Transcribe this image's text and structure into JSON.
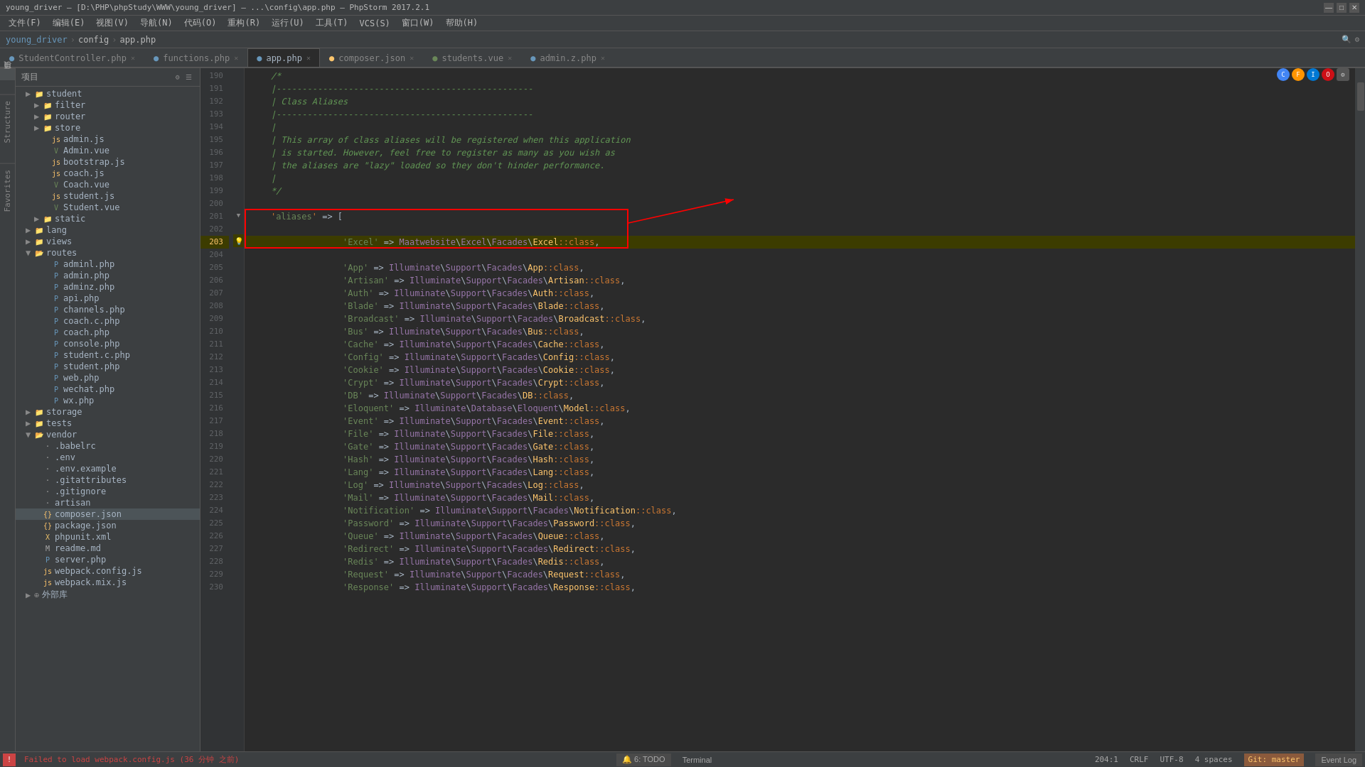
{
  "titleBar": {
    "title": "young_driver – [D:\\PHP\\phpStudy\\WWW\\young_driver] – ...\\config\\app.php – PhpStorm 2017.2.1",
    "minBtn": "—",
    "maxBtn": "□",
    "closeBtn": "✕"
  },
  "menuBar": {
    "items": [
      "文件(F)",
      "编辑(E)",
      "视图(V)",
      "导航(N)",
      "代码(O)",
      "重构(R)",
      "运行(U)",
      "工具(T)",
      "VCS(S)",
      "窗口(W)",
      "帮助(H)"
    ]
  },
  "breadcrumb": {
    "items": [
      "young_driver",
      "config",
      "app.php"
    ]
  },
  "tabs": [
    {
      "label": "StudentController.php",
      "type": "php",
      "active": false
    },
    {
      "label": "functions.php",
      "type": "php",
      "active": false
    },
    {
      "label": "app.php",
      "type": "php",
      "active": true
    },
    {
      "label": "composer.json",
      "type": "json",
      "active": false
    },
    {
      "label": "students.vue",
      "type": "vue",
      "active": false
    },
    {
      "label": "admin.z.php",
      "type": "php",
      "active": false
    }
  ],
  "projectPanel": {
    "title": "项目",
    "treeItems": [
      {
        "label": "student",
        "type": "folder",
        "indent": 2,
        "expanded": false
      },
      {
        "label": "filter",
        "type": "folder",
        "indent": 3,
        "expanded": false
      },
      {
        "label": "router",
        "type": "folder",
        "indent": 3,
        "expanded": false
      },
      {
        "label": "store",
        "type": "folder",
        "indent": 3,
        "expanded": false
      },
      {
        "label": "admin.js",
        "type": "js",
        "indent": 3
      },
      {
        "label": "Admin.vue",
        "type": "vue",
        "indent": 3
      },
      {
        "label": "bootstrap.js",
        "type": "js",
        "indent": 3
      },
      {
        "label": "coach.js",
        "type": "js",
        "indent": 3
      },
      {
        "label": "Coach.vue",
        "type": "vue",
        "indent": 3
      },
      {
        "label": "student.js",
        "type": "js",
        "indent": 3
      },
      {
        "label": "Student.vue",
        "type": "vue",
        "indent": 3
      },
      {
        "label": "static",
        "type": "folder",
        "indent": 2,
        "expanded": false
      },
      {
        "label": "lang",
        "type": "folder",
        "indent": 1,
        "expanded": false
      },
      {
        "label": "views",
        "type": "folder",
        "indent": 1,
        "expanded": false
      },
      {
        "label": "routes",
        "type": "folder",
        "indent": 1,
        "expanded": true
      },
      {
        "label": "adminl.php",
        "type": "php",
        "indent": 2
      },
      {
        "label": "admin.php",
        "type": "php",
        "indent": 2
      },
      {
        "label": "adminz.php",
        "type": "php",
        "indent": 2
      },
      {
        "label": "api.php",
        "type": "php",
        "indent": 2
      },
      {
        "label": "channels.php",
        "type": "php",
        "indent": 2
      },
      {
        "label": "coach.c.php",
        "type": "php",
        "indent": 2
      },
      {
        "label": "coach.php",
        "type": "php",
        "indent": 2
      },
      {
        "label": "console.php",
        "type": "php",
        "indent": 2
      },
      {
        "label": "student.c.php",
        "type": "php",
        "indent": 2
      },
      {
        "label": "student.php",
        "type": "php",
        "indent": 2
      },
      {
        "label": "web.php",
        "type": "php",
        "indent": 2
      },
      {
        "label": "wechat.php",
        "type": "php",
        "indent": 2
      },
      {
        "label": "wx.php",
        "type": "php",
        "indent": 2
      },
      {
        "label": "storage",
        "type": "folder",
        "indent": 1,
        "expanded": false
      },
      {
        "label": "tests",
        "type": "folder",
        "indent": 1,
        "expanded": false
      },
      {
        "label": "vendor",
        "type": "folder",
        "indent": 1,
        "expanded": true
      },
      {
        "label": ".babelrc",
        "type": "txt",
        "indent": 2
      },
      {
        "label": ".env",
        "type": "env",
        "indent": 2
      },
      {
        "label": ".env.example",
        "type": "env",
        "indent": 2
      },
      {
        "label": ".gitattributes",
        "type": "git",
        "indent": 2
      },
      {
        "label": ".gitignore",
        "type": "git",
        "indent": 2
      },
      {
        "label": "artisan",
        "type": "txt",
        "indent": 2
      },
      {
        "label": "composer.json",
        "type": "json",
        "indent": 2,
        "selected": true
      },
      {
        "label": "package.json",
        "type": "json",
        "indent": 2
      },
      {
        "label": "phpunit.xml",
        "type": "xml",
        "indent": 2
      },
      {
        "label": "readme.md",
        "type": "md",
        "indent": 2
      },
      {
        "label": "server.php",
        "type": "php",
        "indent": 2
      },
      {
        "label": "webpack.config.js",
        "type": "js",
        "indent": 2
      },
      {
        "label": "webpack.mix.js",
        "type": "js",
        "indent": 2
      },
      {
        "label": "外部库",
        "type": "folder",
        "indent": 0,
        "expanded": false
      }
    ]
  },
  "leftTabs": [
    "项目",
    "Structure",
    "Favorites"
  ],
  "codeLines": [
    {
      "num": 190,
      "content": "    /*",
      "type": "comment"
    },
    {
      "num": 191,
      "content": "    |--------------------------------------------------",
      "type": "comment"
    },
    {
      "num": 192,
      "content": "    | Class Aliases",
      "type": "comment"
    },
    {
      "num": 193,
      "content": "    |--------------------------------------------------",
      "type": "comment"
    },
    {
      "num": 194,
      "content": "    |",
      "type": "comment"
    },
    {
      "num": 195,
      "content": "    | This array of class aliases will be registered when this application",
      "type": "comment"
    },
    {
      "num": 196,
      "content": "    | is started. However, feel free to register as many as you wish as",
      "type": "comment"
    },
    {
      "num": 197,
      "content": "    | the aliases are \"lazy\" loaded so they don't hinder performance.",
      "type": "comment"
    },
    {
      "num": 198,
      "content": "    |",
      "type": "comment"
    },
    {
      "num": 199,
      "content": "    */",
      "type": "comment"
    },
    {
      "num": 200,
      "content": ""
    },
    {
      "num": 201,
      "content": "    'aliases' => [",
      "type": "highlight_start"
    },
    {
      "num": 202,
      "content": ""
    },
    {
      "num": 203,
      "content": "        'Excel' => Maatwebsite\\Excel\\Facades\\Excel::class,",
      "type": "highlight_excel"
    },
    {
      "num": 204,
      "content": ""
    },
    {
      "num": 205,
      "content": "        'App' => Illuminate\\Support\\Facades\\App::class,",
      "type": "normal"
    },
    {
      "num": 206,
      "content": "        'Artisan' => Illuminate\\Support\\Facades\\Artisan::class,",
      "type": "normal"
    },
    {
      "num": 207,
      "content": "        'Auth' => Illuminate\\Support\\Facades\\Auth::class,",
      "type": "normal"
    },
    {
      "num": 208,
      "content": "        'Blade' => Illuminate\\Support\\Facades\\Blade::class,",
      "type": "normal"
    },
    {
      "num": 209,
      "content": "        'Broadcast' => Illuminate\\Support\\Facades\\Broadcast::class,",
      "type": "normal"
    },
    {
      "num": 210,
      "content": "        'Bus' => Illuminate\\Support\\Facades\\Bus::class,",
      "type": "normal"
    },
    {
      "num": 211,
      "content": "        'Cache' => Illuminate\\Support\\Facades\\Cache::class,",
      "type": "normal"
    },
    {
      "num": 212,
      "content": "        'Config' => Illuminate\\Support\\Facades\\Config::class,",
      "type": "normal"
    },
    {
      "num": 213,
      "content": "        'Cookie' => Illuminate\\Support\\Facades\\Cookie::class,",
      "type": "normal"
    },
    {
      "num": 214,
      "content": "        'Crypt' => Illuminate\\Support\\Facades\\Crypt::class,",
      "type": "normal"
    },
    {
      "num": 215,
      "content": "        'DB' => Illuminate\\Support\\Facades\\DB::class,",
      "type": "normal"
    },
    {
      "num": 216,
      "content": "        'Eloquent' => Illuminate\\Database\\Eloquent\\Model::class,",
      "type": "normal"
    },
    {
      "num": 217,
      "content": "        'Event' => Illuminate\\Support\\Facades\\Event::class,",
      "type": "normal"
    },
    {
      "num": 218,
      "content": "        'File' => Illuminate\\Support\\Facades\\File::class,",
      "type": "normal"
    },
    {
      "num": 219,
      "content": "        'Gate' => Illuminate\\Support\\Facades\\Gate::class,",
      "type": "normal"
    },
    {
      "num": 220,
      "content": "        'Hash' => Illuminate\\Support\\Facades\\Hash::class,",
      "type": "normal"
    },
    {
      "num": 221,
      "content": "        'Lang' => Illuminate\\Support\\Facades\\Lang::class,",
      "type": "normal"
    },
    {
      "num": 222,
      "content": "        'Log' => Illuminate\\Support\\Facades\\Log::class,",
      "type": "normal"
    },
    {
      "num": 223,
      "content": "        'Mail' => Illuminate\\Support\\Facades\\Mail::class,",
      "type": "normal"
    },
    {
      "num": 224,
      "content": "        'Notification' => Illuminate\\Support\\Facades\\Notification::class,",
      "type": "normal"
    },
    {
      "num": 225,
      "content": "        'Password' => Illuminate\\Support\\Facades\\Password::class,",
      "type": "normal"
    },
    {
      "num": 226,
      "content": "        'Queue' => Illuminate\\Support\\Facades\\Queue::class,",
      "type": "normal"
    },
    {
      "num": 227,
      "content": "        'Redirect' => Illuminate\\Support\\Facades\\Redirect::class,",
      "type": "normal"
    },
    {
      "num": 228,
      "content": "        'Redis' => Illuminate\\Support\\Facades\\Redis::class,",
      "type": "normal"
    },
    {
      "num": 229,
      "content": "        'Request' => Illuminate\\Support\\Facades\\Request::class,",
      "type": "normal"
    },
    {
      "num": 230,
      "content": "        'Response' => Illuminate\\Support\\Facades\\Response::class,",
      "type": "normal"
    }
  ],
  "bottomBar": {
    "errorMsg": "Failed to load webpack.config.js (36 分钟 之前)",
    "todoLabel": "6: TODO",
    "terminalLabel": "Terminal",
    "statusRight": "204:1",
    "crlf": "CRLF",
    "encoding": "UTF-8",
    "indent": "4",
    "gitBranch": "Git: master",
    "eventLog": "Event Log"
  }
}
